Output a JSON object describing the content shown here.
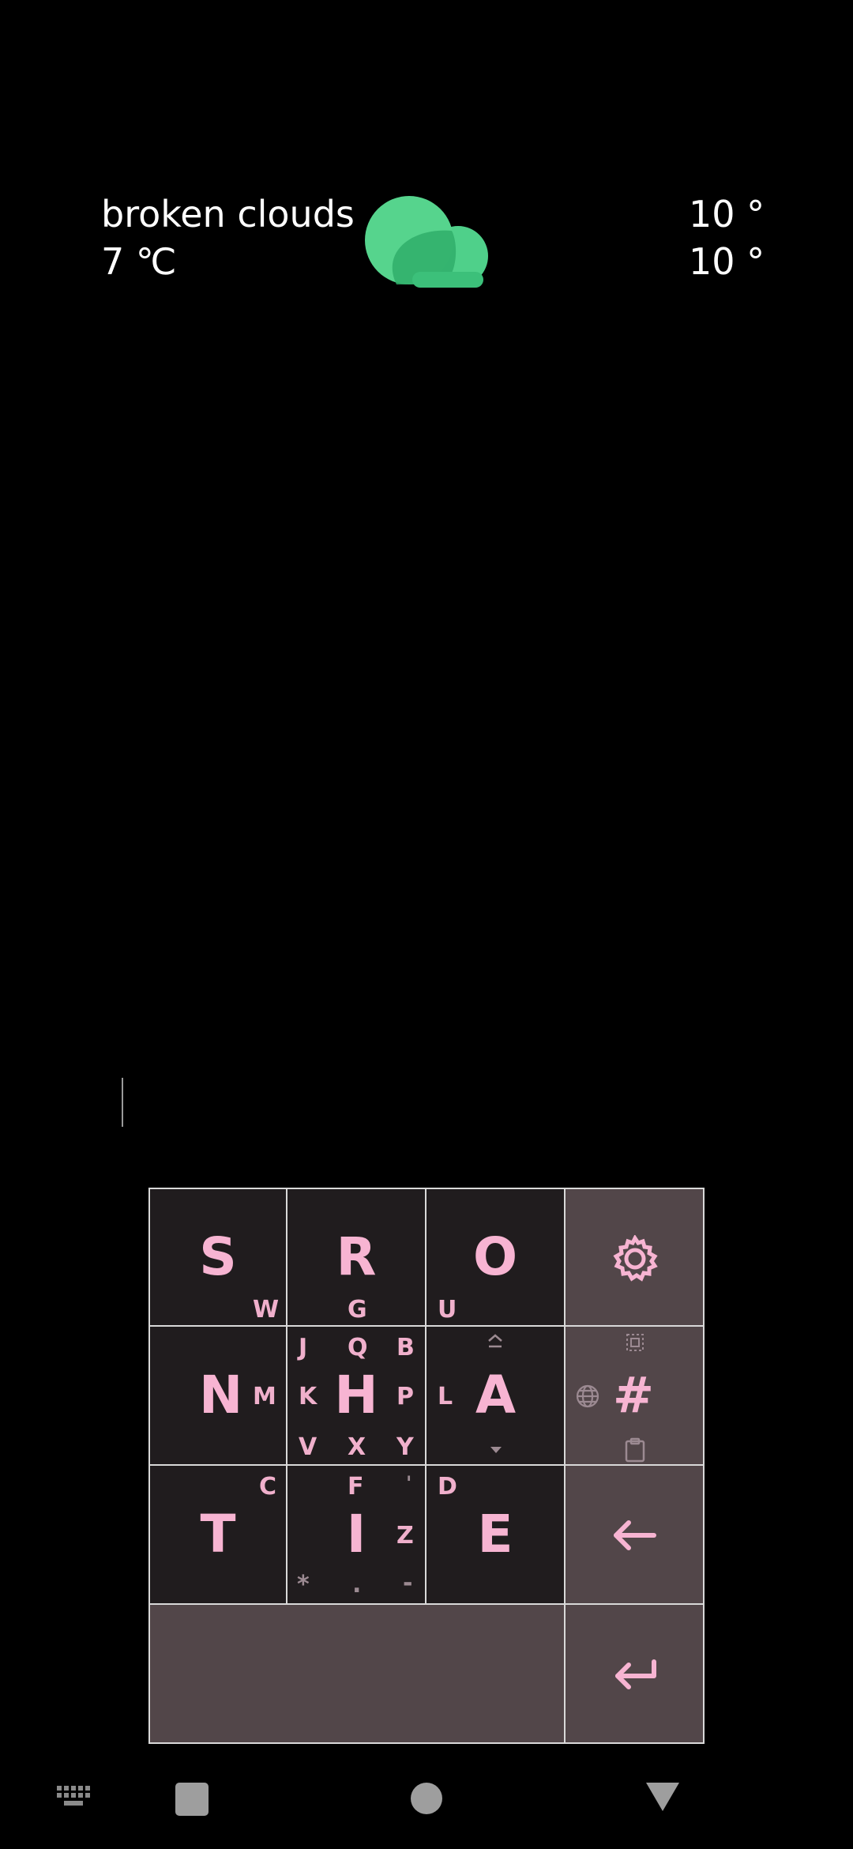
{
  "weather": {
    "description": "broken clouds",
    "temperature": "7 ℃",
    "high": "10 °",
    "low": "10 °",
    "icon": "cloud-icon",
    "icon_color": "#3dbd78"
  },
  "keyboard": {
    "text_color": "#f7b4d2",
    "key_bg": "#201c1e",
    "fn_key_bg": "#524649",
    "keys": {
      "s": {
        "main": "S",
        "sub": "W"
      },
      "r": {
        "main": "R",
        "sub": "G"
      },
      "o": {
        "main": "O",
        "sub": "U"
      },
      "n": {
        "main": "N",
        "sub": "M"
      },
      "h": {
        "main": "H",
        "subs": [
          "J",
          "Q",
          "B",
          "K",
          "P",
          "V",
          "X",
          "Y"
        ]
      },
      "a": {
        "main": "A",
        "sub": "L"
      },
      "t": {
        "main": "T",
        "sub": "C"
      },
      "i": {
        "main": "I",
        "subs": [
          "F",
          "'",
          "Z",
          "*",
          ".",
          "-"
        ]
      },
      "e": {
        "main": "E",
        "sub": "D"
      },
      "numeric": {
        "main": "#"
      }
    }
  },
  "navbar": {
    "icons": [
      "keyboard-icon",
      "recents-icon",
      "home-icon",
      "back-icon"
    ]
  }
}
